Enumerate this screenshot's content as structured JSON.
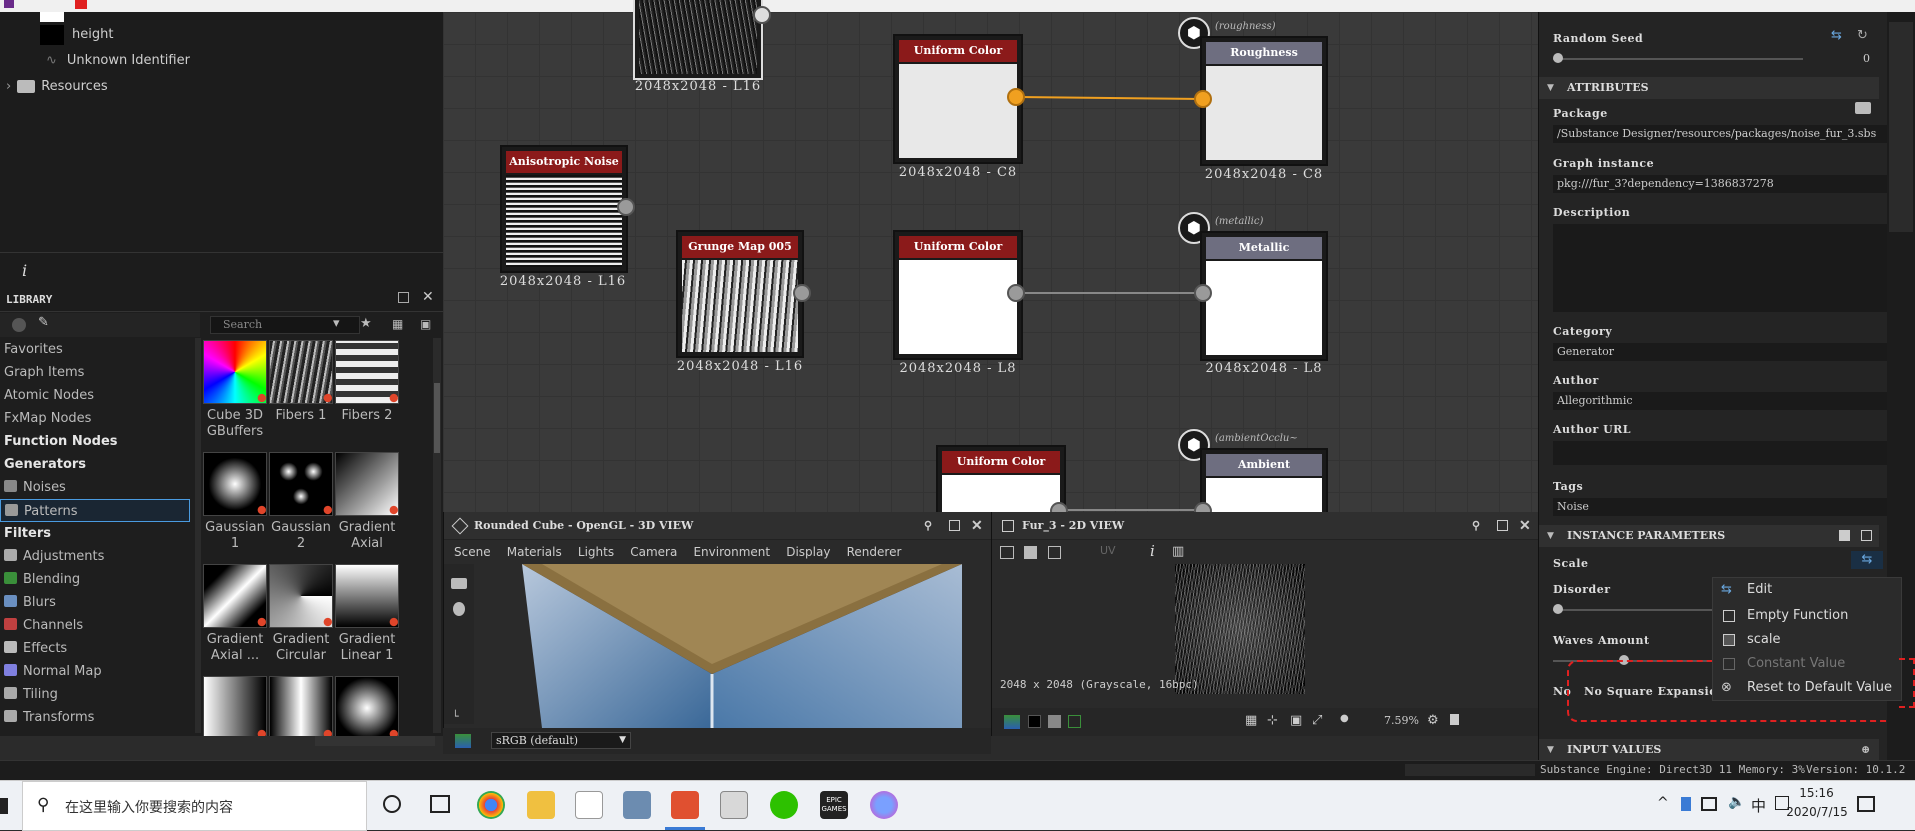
{
  "explorer": {
    "items": [
      {
        "label": "height"
      },
      {
        "label": "Unknown Identifier"
      },
      {
        "label": "Resources"
      }
    ]
  },
  "info_icon": "i",
  "library": {
    "title": "LIBRARY",
    "search_placeholder": "Search",
    "categories": [
      {
        "label": "Favorites",
        "bold": false
      },
      {
        "label": "Graph Items",
        "bold": false
      },
      {
        "label": "Atomic Nodes",
        "bold": false
      },
      {
        "label": "FxMap Nodes",
        "bold": false
      },
      {
        "label": "Function Nodes",
        "bold": true
      },
      {
        "label": "Generators",
        "bold": true
      },
      {
        "label": "Noises",
        "bold": false
      },
      {
        "label": "Patterns",
        "bold": false
      },
      {
        "label": "Filters",
        "bold": true
      },
      {
        "label": "Adjustments",
        "bold": false
      },
      {
        "label": "Blending",
        "bold": false
      },
      {
        "label": "Blurs",
        "bold": false
      },
      {
        "label": "Channels",
        "bold": false
      },
      {
        "label": "Effects",
        "bold": false
      },
      {
        "label": "Normal Map",
        "bold": false
      },
      {
        "label": "Tiling",
        "bold": false
      },
      {
        "label": "Transforms",
        "bold": false
      }
    ],
    "thumbnails": [
      {
        "line1": "Cube 3D",
        "line2": "GBuffers"
      },
      {
        "line1": "Fibers 1",
        "line2": ""
      },
      {
        "line1": "Fibers 2",
        "line2": ""
      },
      {
        "line1": "Gaussian",
        "line2": "1"
      },
      {
        "line1": "Gaussian",
        "line2": "2"
      },
      {
        "line1": "Gradient",
        "line2": "Axial"
      },
      {
        "line1": "Gradient",
        "line2": "Axial ..."
      },
      {
        "line1": "Gradient",
        "line2": "Circular"
      },
      {
        "line1": "Gradient",
        "line2": "Linear 1"
      },
      {
        "line1": "",
        "line2": ""
      },
      {
        "line1": "",
        "line2": ""
      },
      {
        "line1": "",
        "line2": ""
      }
    ]
  },
  "graph": {
    "nodes": [
      {
        "title": "",
        "label": "2048x2048 - L16"
      },
      {
        "title": "Anisotropic Noise",
        "label": "2048x2048 - L16"
      },
      {
        "title": "Grunge Map 005",
        "label": "2048x2048 - L16"
      },
      {
        "title": "Uniform Color",
        "label": "2048x2048 - C8"
      },
      {
        "title": "Uniform Color",
        "label": "2048x2048 - L8"
      },
      {
        "title": "Uniform Color",
        "label": ""
      },
      {
        "title": "Roughness",
        "label": "2048x2048 - C8",
        "tag": "(roughness)"
      },
      {
        "title": "Metallic",
        "label": "2048x2048 - L8",
        "tag": "(metallic)"
      },
      {
        "title": "Ambient Occlusion",
        "label": "",
        "tag": "(ambientOcclu~"
      }
    ]
  },
  "view3d": {
    "title": "Rounded Cube - OpenGL - 3D VIEW",
    "menu": [
      "Scene",
      "Materials",
      "Lights",
      "Camera",
      "Environment",
      "Display",
      "Renderer"
    ],
    "colorspace": "sRGB (default)"
  },
  "view2d": {
    "title": "Fur_3 - 2D VIEW",
    "image_info": "2048 x 2048 (Grayscale, 16bpc)",
    "zoom": "7.59%",
    "uv_label": "UV"
  },
  "props": {
    "random_seed_label": "Random Seed",
    "random_seed_value": "0",
    "attributes_section": "ATTRIBUTES",
    "package_label": "Package",
    "package_value": "/Substance Designer/resources/packages/noise_fur_3.sbs",
    "graph_instance_label": "Graph instance",
    "graph_instance_value": "pkg:///fur_3?dependency=1386837278",
    "description_label": "Description",
    "category_label": "Category",
    "category_value": "Generator",
    "author_label": "Author",
    "author_value": "Allegorithmic",
    "author_url_label": "Author URL",
    "tags_label": "Tags",
    "tags_value": "Noise",
    "instance_params_section": "INSTANCE PARAMETERS",
    "scale_label": "Scale",
    "disorder_label": "Disorder",
    "waves_amount_label": "Waves Amount",
    "no_square_label": "No Square Expansion",
    "no_square_prefix": "No",
    "input_values_section": "INPUT VALUES"
  },
  "context_menu": {
    "items": [
      "Edit",
      "Empty Function",
      "scale",
      "Constant Value",
      "Reset to Default Value"
    ]
  },
  "statusbar": {
    "engine": "Substance Engine: Direct3D 11 Memory: 3%",
    "version": "Version: 10.1.2"
  },
  "taskbar": {
    "search_placeholder": "在这里输入你要搜索的内容",
    "time": "15:16",
    "date": "2020/7/15",
    "ime": "中",
    "epic_label": "EPIC GAMES"
  }
}
